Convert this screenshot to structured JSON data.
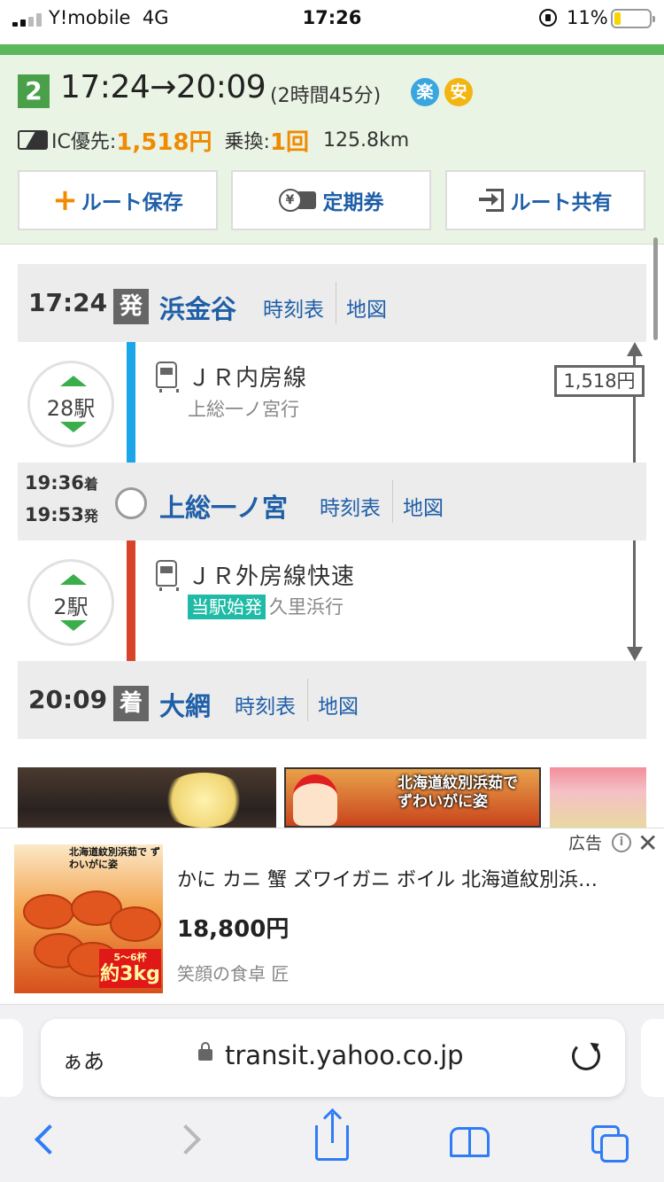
{
  "status_bar": {
    "carrier": "Y!mobile",
    "network": "4G",
    "time": "17:26",
    "battery": "11%"
  },
  "summary": {
    "route_number": "2",
    "times": "17:24→20:09",
    "duration": "(2時間45分)",
    "badges": [
      "楽",
      "安"
    ],
    "ic_label": "IC優先:",
    "fare": "1,518円",
    "transfer_label": "乗換:",
    "transfer_count": "1回",
    "distance": "125.8km",
    "buttons": {
      "save": "ルート保存",
      "pass": "定期券",
      "share": "ルート共有"
    }
  },
  "route": {
    "stations": [
      {
        "time": "17:24",
        "tag": "発",
        "name": "浜金谷",
        "timetable": "時刻表",
        "map": "地図"
      },
      {
        "arrive": "19:36",
        "arrive_suffix": "着",
        "depart": "19:53",
        "depart_suffix": "発",
        "name": "上総一ノ宮",
        "timetable": "時刻表",
        "map": "地図"
      },
      {
        "time": "20:09",
        "tag": "着",
        "name": "大網",
        "timetable": "時刻表",
        "map": "地図"
      }
    ],
    "legs": [
      {
        "stops": "28駅",
        "line": "ＪＲ内房線",
        "destination": "上総一ノ宮行",
        "color": "#1aa6e8"
      },
      {
        "stops": "2駅",
        "line": "ＪＲ外房線快速",
        "badge": "当駅始発",
        "destination": "久里浜行",
        "color": "#d9432a"
      }
    ],
    "fare_marker": "1,518円"
  },
  "thumbnails": {
    "crab_text_1": "北海道紋別浜茹で",
    "crab_text_2": "ずわいがに姿"
  },
  "ad": {
    "label": "広告",
    "title": "かに カニ 蟹 ズワイガニ ボイル 北海道紋別浜…",
    "price": "18,800円",
    "shop": "笑顔の食卓 匠",
    "image_top_text": "北海道紋別浜茹で ずわいがに姿",
    "image_kg_small": "5〜6杯",
    "image_kg_big": "約3kg"
  },
  "safari": {
    "aa": "ぁあ",
    "url": "transit.yahoo.co.jp"
  }
}
